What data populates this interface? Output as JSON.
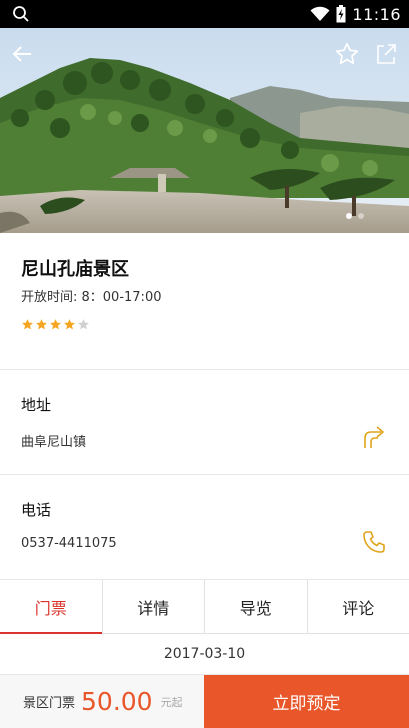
{
  "status_bar": {
    "time": "11:16"
  },
  "hero": {
    "slide_count": 2,
    "active_slide": 1
  },
  "scenic": {
    "name": "尼山孔庙景区",
    "hours": "开放时间: 8：00-17:00",
    "rating": 4,
    "rating_max": 5,
    "star_color": "#f4a623"
  },
  "address": {
    "label": "地址",
    "value": "曲阜尼山镇"
  },
  "phone": {
    "label": "电话",
    "value": "0537-4411075"
  },
  "tabs": [
    {
      "label": "门票",
      "active": true
    },
    {
      "label": "详情",
      "active": false
    },
    {
      "label": "导览",
      "active": false
    },
    {
      "label": "评论",
      "active": false
    }
  ],
  "ticket": {
    "date": "2017-03-10"
  },
  "booking": {
    "price_label": "景区门票",
    "price": "50.00",
    "price_unit": "元起",
    "book_label": "立即预定"
  },
  "colors": {
    "accent": "#e8562a",
    "tab_active": "#d9332c",
    "icon_gold": "#e0a41c"
  }
}
